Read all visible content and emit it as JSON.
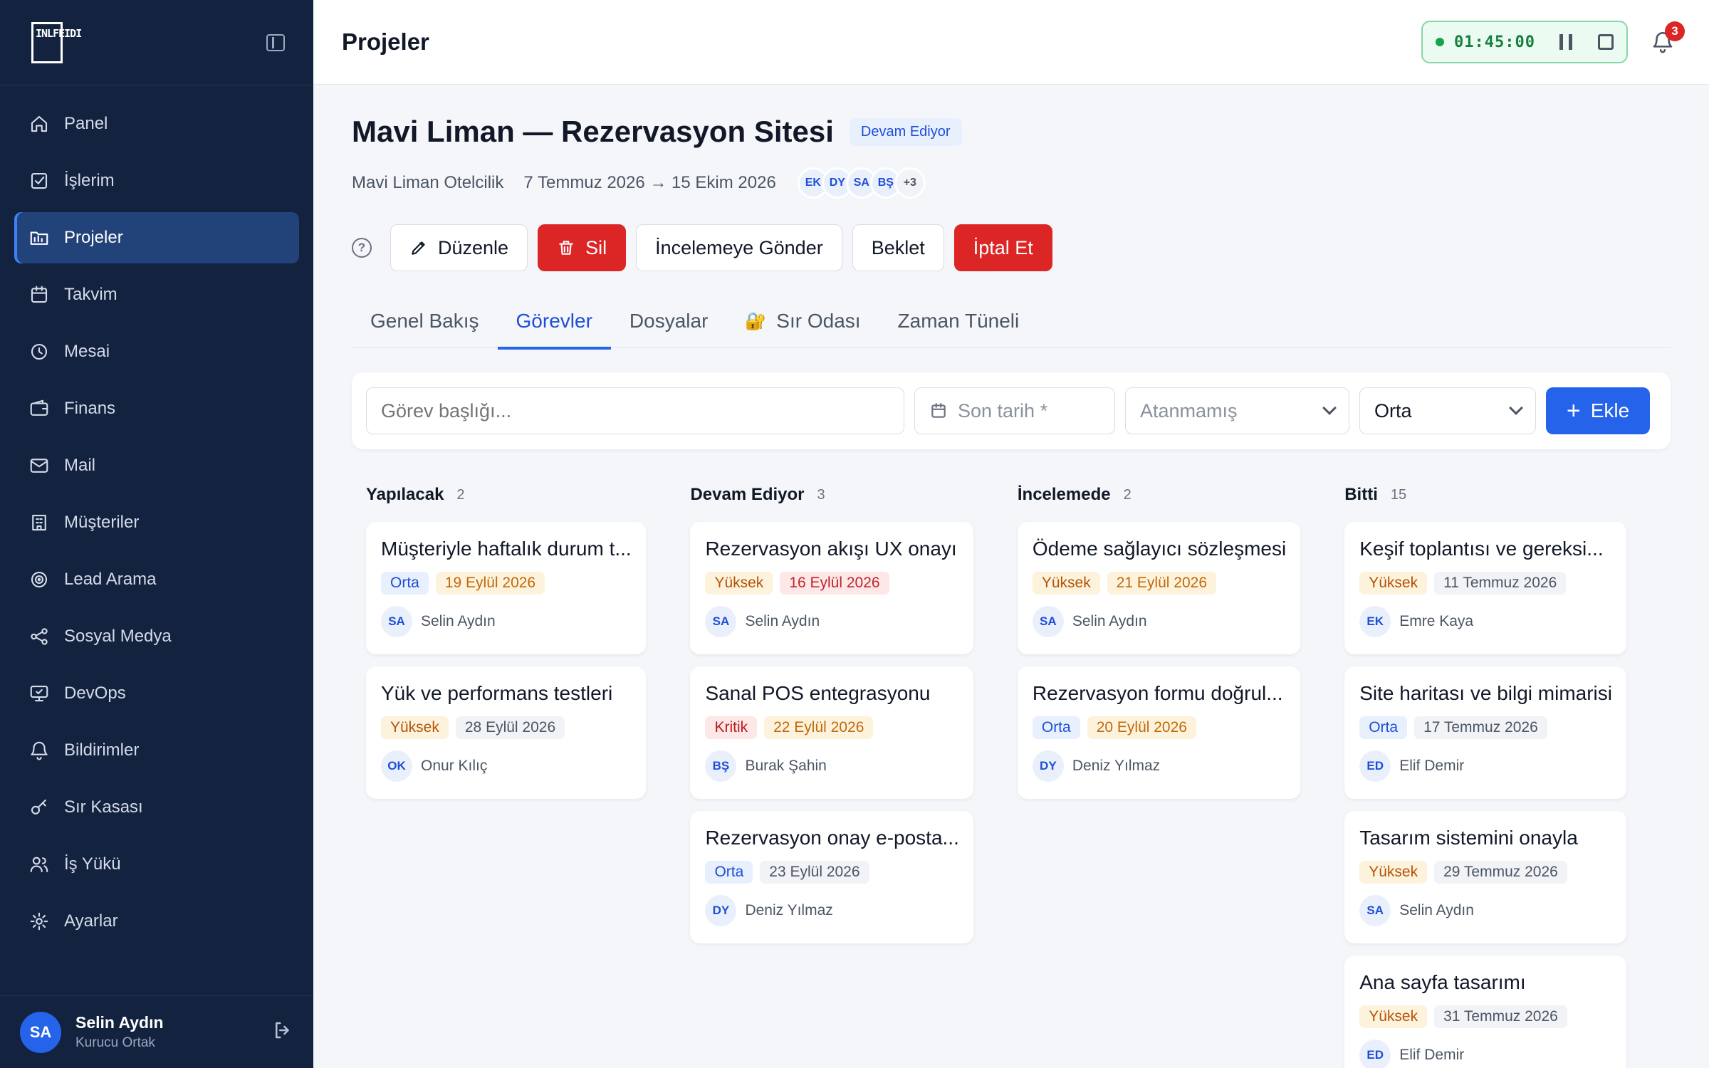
{
  "sidebar": {
    "logo_text": "INLFEIDI",
    "items": [
      {
        "label": "Panel",
        "icon": "home-icon"
      },
      {
        "label": "İşlerim",
        "icon": "checkbox-icon"
      },
      {
        "label": "Projeler",
        "icon": "folder-icon",
        "active": true
      },
      {
        "label": "Takvim",
        "icon": "calendar-icon"
      },
      {
        "label": "Mesai",
        "icon": "clock-icon"
      },
      {
        "label": "Finans",
        "icon": "wallet-icon"
      },
      {
        "label": "Mail",
        "icon": "mail-icon"
      },
      {
        "label": "Müşteriler",
        "icon": "building-icon"
      },
      {
        "label": "Lead Arama",
        "icon": "target-icon"
      },
      {
        "label": "Sosyal Medya",
        "icon": "share-icon"
      },
      {
        "label": "DevOps",
        "icon": "monitor-icon"
      },
      {
        "label": "Bildirimler",
        "icon": "bell-icon"
      },
      {
        "label": "Sır Kasası",
        "icon": "key-icon"
      },
      {
        "label": "İş Yükü",
        "icon": "users-icon"
      },
      {
        "label": "Ayarlar",
        "icon": "gear-icon"
      }
    ],
    "user": {
      "initials": "SA",
      "name": "Selin Aydın",
      "role": "Kurucu Ortak"
    }
  },
  "header": {
    "title": "Projeler",
    "timer": "01:45:00",
    "notification_count": "3"
  },
  "project": {
    "title": "Mavi Liman — Rezervasyon Sitesi",
    "status": "Devam Ediyor",
    "client": "Mavi Liman Otelcilik",
    "dates": "7 Temmuz 2026 → 15 Ekim 2026",
    "members": [
      "EK",
      "DY",
      "SA",
      "BŞ"
    ],
    "members_more": "+3"
  },
  "actions": {
    "help": "?",
    "edit": "Düzenle",
    "delete": "Sil",
    "review": "İncelemeye Gönder",
    "hold": "Beklet",
    "cancel": "İptal Et"
  },
  "tabs": [
    {
      "label": "Genel Bakış"
    },
    {
      "label": "Görevler",
      "active": true
    },
    {
      "label": "Dosyalar"
    },
    {
      "label": "Sır Odası",
      "icon": "🔐"
    },
    {
      "label": "Zaman Tüneli"
    }
  ],
  "addbar": {
    "title_placeholder": "Görev başlığı...",
    "date_placeholder": "Son tarih *",
    "assignee_value": "Atanmamış",
    "priority_value": "Orta",
    "add_label": "Ekle"
  },
  "colors": {
    "accent": "#2563eb",
    "sidebar": "#13223f",
    "danger": "#dc2626"
  },
  "board": [
    {
      "title": "Yapılacak",
      "count": "2",
      "cards": [
        {
          "title": "Müşteriyle haftalık durum t...",
          "priority": "Orta",
          "pclass": "orta",
          "date": "19 Eylül 2026",
          "dclass": "date-orange",
          "initials": "SA",
          "assignee": "Selin Aydın"
        },
        {
          "title": "Yük ve performans testleri",
          "priority": "Yüksek",
          "pclass": "yuksek",
          "date": "28 Eylül 2026",
          "dclass": "date-gray",
          "initials": "OK",
          "assignee": "Onur Kılıç"
        }
      ]
    },
    {
      "title": "Devam Ediyor",
      "count": "3",
      "cards": [
        {
          "title": "Rezervasyon akışı UX onayı",
          "priority": "Yüksek",
          "pclass": "yuksek",
          "date": "16 Eylül 2026",
          "dclass": "date-red",
          "initials": "SA",
          "assignee": "Selin Aydın"
        },
        {
          "title": "Sanal POS entegrasyonu",
          "priority": "Kritik",
          "pclass": "kritik",
          "date": "22 Eylül 2026",
          "dclass": "date-orange",
          "initials": "BŞ",
          "assignee": "Burak Şahin"
        },
        {
          "title": "Rezervasyon onay e-posta...",
          "priority": "Orta",
          "pclass": "orta",
          "date": "23 Eylül 2026",
          "dclass": "date-gray",
          "initials": "DY",
          "assignee": "Deniz Yılmaz"
        }
      ]
    },
    {
      "title": "İncelemede",
      "count": "2",
      "cards": [
        {
          "title": "Ödeme sağlayıcı sözleşmesi",
          "priority": "Yüksek",
          "pclass": "yuksek",
          "date": "21 Eylül 2026",
          "dclass": "date-orange",
          "initials": "SA",
          "assignee": "Selin Aydın"
        },
        {
          "title": "Rezervasyon formu doğrul...",
          "priority": "Orta",
          "pclass": "orta",
          "date": "20 Eylül 2026",
          "dclass": "date-orange",
          "initials": "DY",
          "assignee": "Deniz Yılmaz"
        }
      ]
    },
    {
      "title": "Bitti",
      "count": "15",
      "cards": [
        {
          "title": "Keşif toplantısı ve gereksi...",
          "priority": "Yüksek",
          "pclass": "yuksek",
          "date": "11 Temmuz 2026",
          "dclass": "date-gray",
          "initials": "EK",
          "assignee": "Emre Kaya"
        },
        {
          "title": "Site haritası ve bilgi mimarisi",
          "priority": "Orta",
          "pclass": "orta",
          "date": "17 Temmuz 2026",
          "dclass": "date-gray",
          "initials": "ED",
          "assignee": "Elif Demir"
        },
        {
          "title": "Tasarım sistemini onayla",
          "priority": "Yüksek",
          "pclass": "yuksek",
          "date": "29 Temmuz 2026",
          "dclass": "date-gray",
          "initials": "SA",
          "assignee": "Selin Aydın"
        },
        {
          "title": "Ana sayfa tasarımı",
          "priority": "Yüksek",
          "pclass": "yuksek",
          "date": "31 Temmuz 2026",
          "dclass": "date-gray",
          "initials": "ED",
          "assignee": "Elif Demir"
        }
      ]
    }
  ]
}
